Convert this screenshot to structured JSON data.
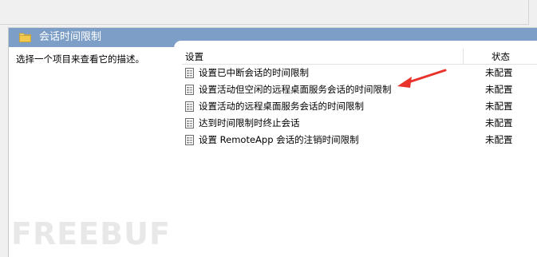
{
  "header": {
    "title": "会话时间限制",
    "folder_icon": "folder-icon"
  },
  "description_pane": {
    "text": "选择一个项目来查看它的描述。"
  },
  "list": {
    "columns": {
      "setting": "设置",
      "status": "状态"
    },
    "rows": [
      {
        "name": "设置已中断会话的时间限制",
        "status": "未配置"
      },
      {
        "name": "设置活动但空闲的远程桌面服务会话的时间限制",
        "status": "未配置"
      },
      {
        "name": "设置活动的远程桌面服务会话的时间限制",
        "status": "未配置"
      },
      {
        "name": "达到时间限制时终止会话",
        "status": "未配置"
      },
      {
        "name": "设置 RemoteApp 会话的注销时间限制",
        "status": "未配置"
      }
    ]
  },
  "annotation": {
    "arrow_color": "#e8322a"
  },
  "watermark": {
    "text": "FREEBUF"
  },
  "colors": {
    "header_band": "#7d9ec6",
    "folder": "#f2c94c"
  }
}
